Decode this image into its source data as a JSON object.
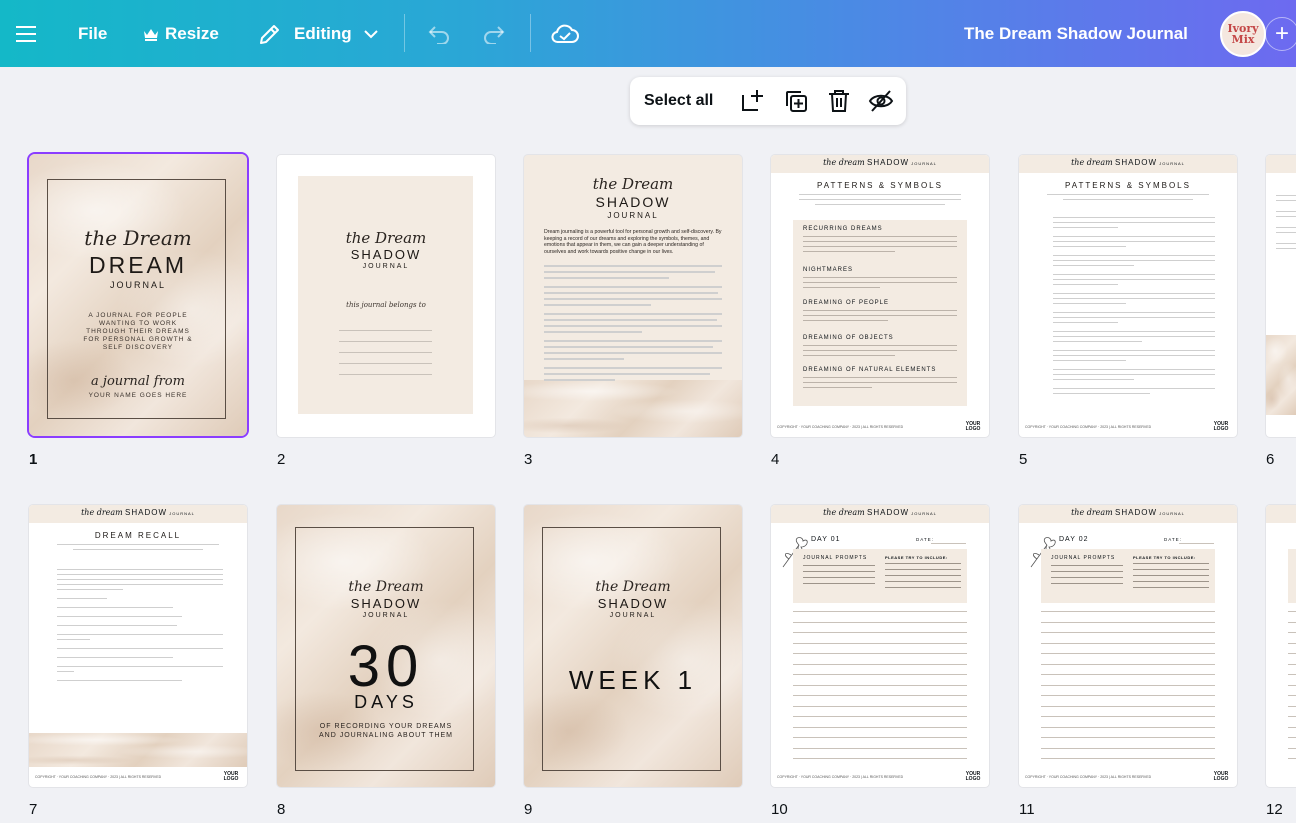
{
  "topbar": {
    "file_label": "File",
    "resize_label": "Resize",
    "editing_label": "Editing",
    "doc_title": "The Dream Shadow Journal",
    "avatar_text": "Ivory Mix",
    "brand_gradient": [
      "#14b8c8",
      "#6d6af0"
    ]
  },
  "selection_toolbar": {
    "select_all_label": "Select all",
    "icons": [
      "add-page-icon",
      "duplicate-icon",
      "trash-icon",
      "hide-icon"
    ]
  },
  "pages": [
    {
      "number": "1",
      "selected": true
    },
    {
      "number": "2"
    },
    {
      "number": "3"
    },
    {
      "number": "4"
    },
    {
      "number": "5"
    },
    {
      "number": "6"
    },
    {
      "number": "7"
    },
    {
      "number": "8"
    },
    {
      "number": "9"
    },
    {
      "number": "10"
    },
    {
      "number": "11"
    },
    {
      "number": "12"
    }
  ],
  "p1": {
    "script": "the Dream",
    "title": "DREAM",
    "subtitle": "JOURNAL",
    "tagline": "A JOURNAL FOR PEOPLE WANTING TO WORK THROUGH THEIR DREAMS FOR PERSONAL GROWTH & SELF DISCOVERY",
    "from": "a journal from",
    "name": "YOUR NAME GOES HERE"
  },
  "p2": {
    "script": "the Dream",
    "title": "SHADOW",
    "subtitle": "JOURNAL",
    "belongs": "this journal belongs to"
  },
  "p3": {
    "script": "the Dream",
    "title": "SHADOW",
    "subtitle": "JOURNAL",
    "lead": "Dream journaling is a powerful tool for personal growth and self-discovery. By keeping a record of our dreams and exploring the symbols, themes, and emotions that appear in them, we can gain a deeper understanding of ourselves and work towards positive change in our lives."
  },
  "header": {
    "script": "the dream",
    "title": "SHADOW",
    "small": "JOURNAL"
  },
  "p4": {
    "heading": "PATTERNS & SYMBOLS",
    "sections": [
      "RECURRING DREAMS",
      "NIGHTMARES",
      "DREAMING OF PEOPLE",
      "DREAMING OF OBJECTS",
      "DREAMING OF NATURAL ELEMENTS"
    ]
  },
  "p5": {
    "heading": "PATTERNS & SYMBOLS"
  },
  "p7": {
    "heading": "DREAM RECALL"
  },
  "p8": {
    "script": "the Dream",
    "title": "SHADOW",
    "subtitle": "JOURNAL",
    "big": "30",
    "days": "DAYS",
    "caption": "OF RECORDING YOUR DREAMS AND JOURNALING ABOUT THEM"
  },
  "p9": {
    "script": "the Dream",
    "title": "SHADOW",
    "subtitle": "JOURNAL",
    "week": "WEEK 1"
  },
  "p10": {
    "day": "DAY 01",
    "date": "DATE:",
    "prompts": "JOURNAL PROMPTS",
    "include": "PLEASE TRY TO INCLUDE:"
  },
  "p11": {
    "day": "DAY 02",
    "date": "DATE:",
    "prompts": "JOURNAL PROMPTS",
    "include": "PLEASE TRY TO INCLUDE:"
  },
  "footer": {
    "copyright": "COPYRIGHT · YOUR COACHING COMPANY · 2023 | ALL RIGHTS RESERVED",
    "logo": "YOUR LOGO"
  }
}
